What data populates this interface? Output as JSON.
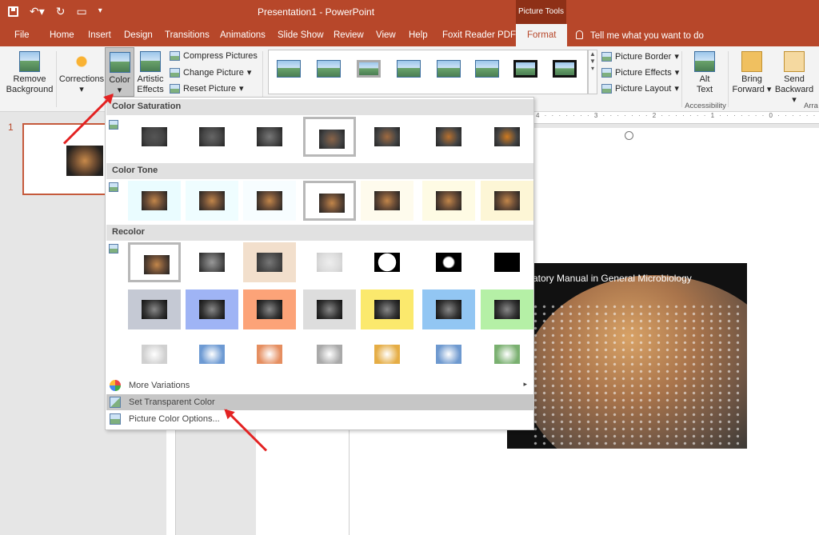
{
  "app": {
    "title": "Presentation1  -  PowerPoint",
    "context_tab": "Picture Tools"
  },
  "tabs": [
    {
      "label": "File"
    },
    {
      "label": "Home"
    },
    {
      "label": "Insert"
    },
    {
      "label": "Design"
    },
    {
      "label": "Transitions"
    },
    {
      "label": "Animations"
    },
    {
      "label": "Slide Show"
    },
    {
      "label": "Review"
    },
    {
      "label": "View"
    },
    {
      "label": "Help"
    },
    {
      "label": "Foxit Reader PDF"
    },
    {
      "label": "Format"
    }
  ],
  "tell_me": "Tell me what you want to do",
  "ribbon": {
    "remove_background": [
      "Remove",
      "Background"
    ],
    "corrections": "Corrections",
    "color": "Color",
    "artistic": [
      "Artistic",
      "Effects"
    ],
    "compress": "Compress Pictures",
    "change": "Change Picture",
    "reset": "Reset Picture",
    "border": "Picture Border",
    "effects": "Picture Effects",
    "layout": "Picture Layout",
    "alt_text": [
      "Alt",
      "Text"
    ],
    "accessibility": "Accessibility",
    "bring_forward": [
      "Bring",
      "Forward"
    ],
    "send_backward": [
      "Send",
      "Backward"
    ],
    "arrange": "Arra"
  },
  "dropdown": {
    "sections": [
      "Color Saturation",
      "Color Tone",
      "Recolor"
    ],
    "menu": [
      "More Variations",
      "Set Transparent Color",
      "Picture Color Options..."
    ]
  },
  "slide": {
    "number": "1",
    "caption": "ratory Manual in General Microbiology"
  },
  "ruler": "4 · · · · · · · 3 · · · · · · · 2 · · · · · · · 1 · · · · · · · 0 · · · · · · · 1 · · ·",
  "colors": {
    "accent": "#b7472a",
    "highlight": "#c6c6c6",
    "annotation_arrow": "#e32222"
  }
}
